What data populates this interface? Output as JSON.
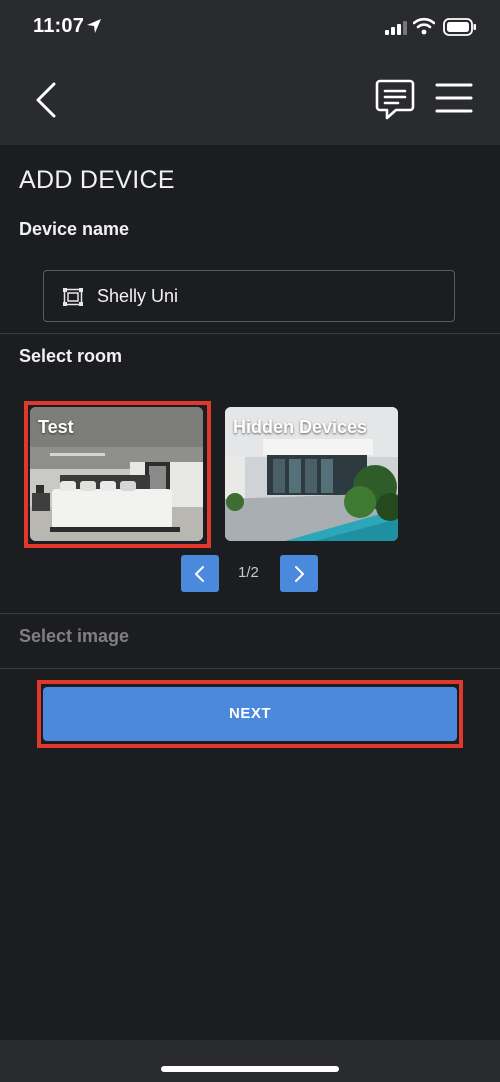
{
  "status_bar": {
    "time": "11:07",
    "icons": [
      "location-arrow-icon",
      "cellular-signal-icon",
      "wifi-icon",
      "battery-icon"
    ]
  },
  "nav": {
    "back_icon": "chevron-left-icon",
    "chat_icon": "chat-bubble-icon",
    "menu_icon": "hamburger-menu-icon"
  },
  "page": {
    "title": "ADD DEVICE"
  },
  "device_name": {
    "label": "Device name",
    "value": "Shelly Uni",
    "icon": "device-module-icon"
  },
  "select_room": {
    "label": "Select room",
    "rooms": [
      {
        "name": "Test",
        "selected": true
      },
      {
        "name": "Hidden Devices",
        "selected": false
      }
    ],
    "pagination": {
      "text": "1/2",
      "prev_icon": "chevron-left-icon",
      "next_icon": "chevron-right-icon"
    }
  },
  "select_image": {
    "label": "Select image"
  },
  "actions": {
    "next_label": "NEXT"
  },
  "colors": {
    "background": "#1c1d21",
    "header": "#2a2b2f",
    "accent": "#4a89dc",
    "highlight": "#e0392b"
  }
}
